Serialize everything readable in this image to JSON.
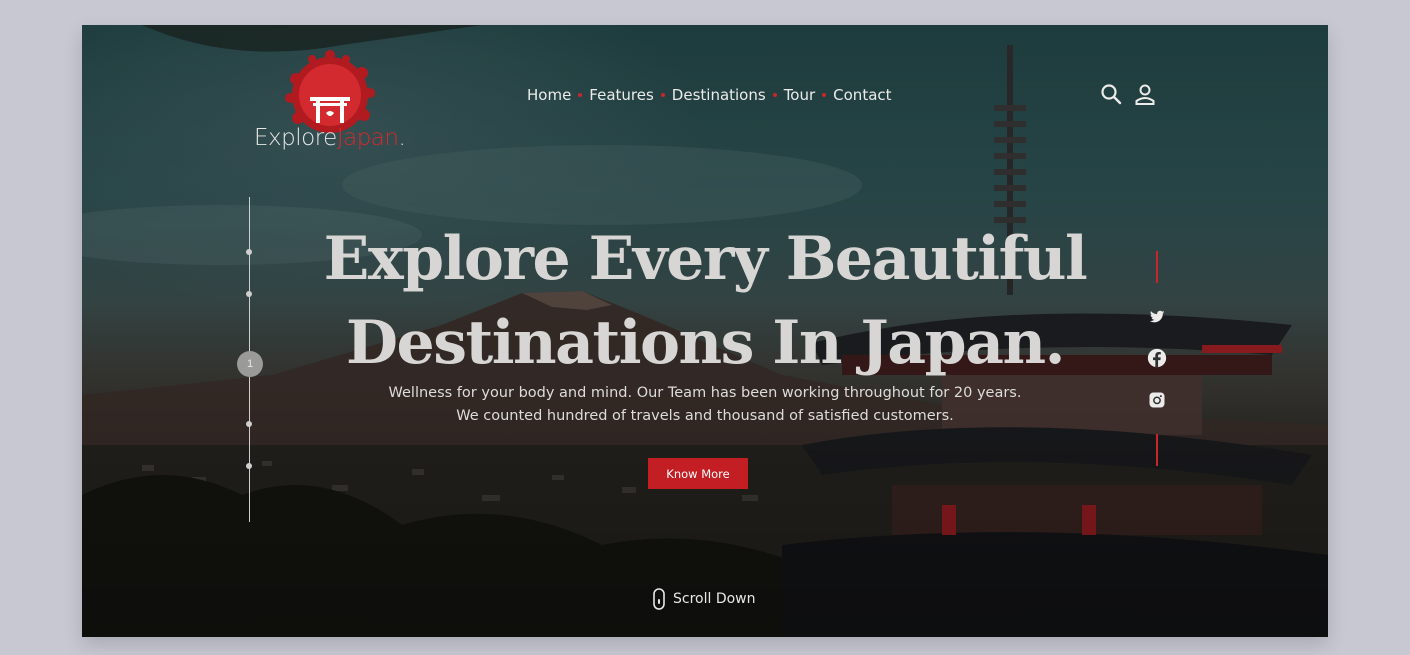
{
  "brand": {
    "name_part1": "Explore",
    "name_part2": "Japan",
    "name_dot": "."
  },
  "nav": {
    "items": [
      {
        "label": "Home"
      },
      {
        "label": "Features"
      },
      {
        "label": "Destinations"
      },
      {
        "label": "Tour"
      },
      {
        "label": "Contact"
      }
    ]
  },
  "header_icons": [
    "search-icon",
    "user-icon"
  ],
  "slider": {
    "active_label": "1"
  },
  "hero": {
    "title_line1": "Explore Every Beautiful",
    "title_line2": "Destinations In Japan.",
    "subtitle_line1": "Wellness for your body and mind. Our Team has been working throughout for 20 years.",
    "subtitle_line2": "We counted hundred of travels and thousand of satisfied customers.",
    "cta_label": "Know More"
  },
  "social": [
    "twitter-icon",
    "facebook-icon",
    "instagram-icon"
  ],
  "scroll_label": "Scroll Down",
  "colors": {
    "accent": "#c21e23",
    "text": "#ecebea"
  }
}
